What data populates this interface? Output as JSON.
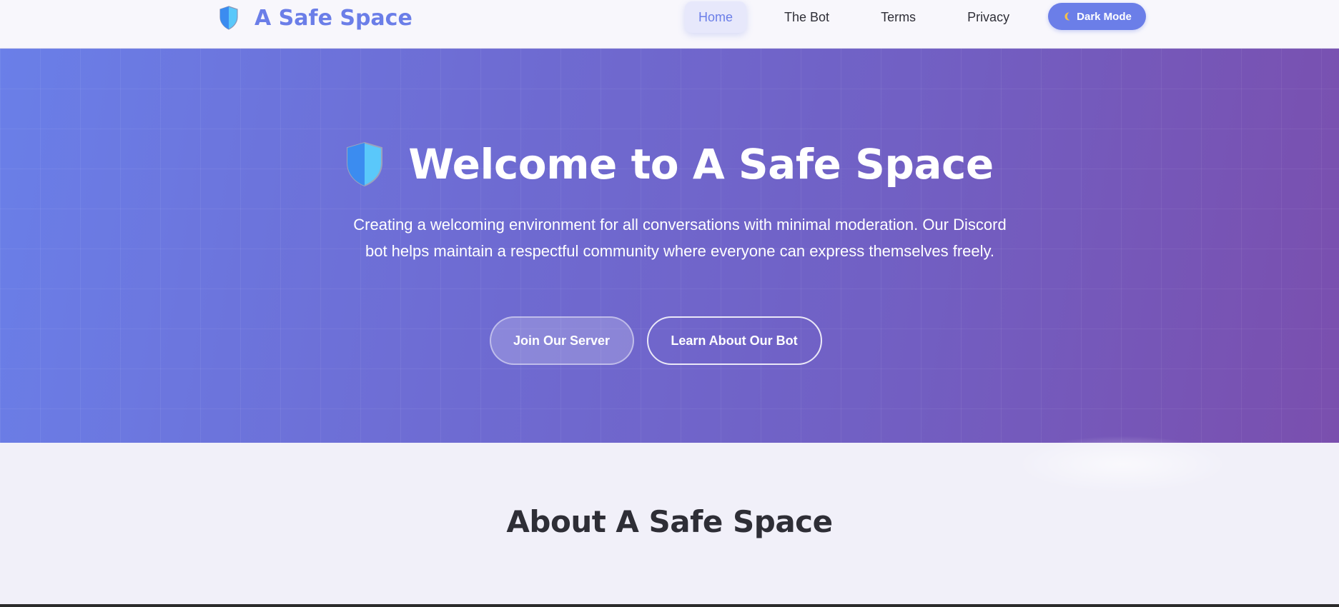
{
  "header": {
    "brand_title": "A Safe Space",
    "brand_icon": "shield-icon",
    "nav": [
      {
        "label": "Home",
        "active": true
      },
      {
        "label": "The Bot",
        "active": false
      },
      {
        "label": "Terms",
        "active": false
      },
      {
        "label": "Privacy",
        "active": false
      }
    ],
    "dark_mode_label": "Dark Mode",
    "dark_mode_icon": "moon-icon"
  },
  "hero": {
    "title": "Welcome to A Safe Space",
    "subtitle": "Creating a welcoming environment for all conversations with minimal moderation. Our Discord bot helps maintain a respectful community where everyone can express themselves freely.",
    "primary_button": "Join Our Server",
    "secondary_button": "Learn About Our Bot"
  },
  "about": {
    "title": "About A Safe Space"
  },
  "colors": {
    "accent": "#6b7ee8",
    "hero_start": "#6a7fe8",
    "hero_end": "#7a4fae",
    "shield_left": "#3b8cf0",
    "shield_right": "#5ac8fa",
    "text_dark": "#2e2e36"
  }
}
